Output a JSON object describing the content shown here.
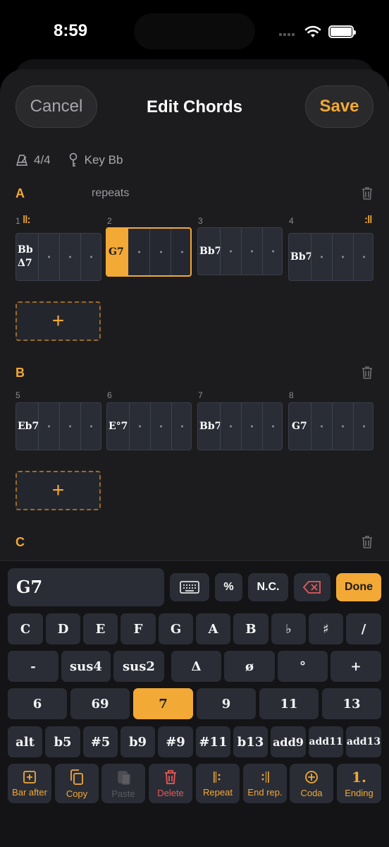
{
  "status_bar": {
    "time": "8:59"
  },
  "header": {
    "cancel_label": "Cancel",
    "title": "Edit Chords",
    "save_label": "Save"
  },
  "meta": {
    "time_signature": "4/4",
    "key": "Key Bb"
  },
  "sections": {
    "a": {
      "letter": "A",
      "note": "repeats",
      "bars": [
        {
          "num": "1",
          "chord_line1": "Bb",
          "chord_line2": "Δ7"
        },
        {
          "num": "2",
          "chord": "G7",
          "selected": true
        },
        {
          "num": "3",
          "chord": "Bb7"
        },
        {
          "num": "4",
          "chord": "Bb7"
        }
      ]
    },
    "b": {
      "letter": "B",
      "bars": [
        {
          "num": "5",
          "chord": "Eb7"
        },
        {
          "num": "6",
          "chord": "E°7"
        },
        {
          "num": "7",
          "chord": "Bb7"
        },
        {
          "num": "8",
          "chord": "G7"
        }
      ]
    },
    "c": {
      "letter": "C"
    }
  },
  "add_measure_label": "+",
  "keyboard": {
    "current_chord": "G7",
    "percent_label": "%",
    "nc_label": "N.C.",
    "done_label": "Done",
    "row_roots": [
      "C",
      "D",
      "E",
      "F",
      "G",
      "A",
      "B",
      "♭",
      "♯",
      "/"
    ],
    "row_quality": [
      "-",
      "sus4",
      "sus2",
      "Δ",
      "ø",
      "°",
      "+"
    ],
    "row_ext": [
      "6",
      "69",
      "7",
      "9",
      "11",
      "13"
    ],
    "active_ext": "7",
    "row_alt": [
      "alt",
      "b5",
      "#5",
      "b9",
      "#9",
      "#11",
      "b13",
      "add9",
      "add11",
      "add13"
    ],
    "actions": [
      {
        "label": "Bar after",
        "icon": "plus-square-icon"
      },
      {
        "label": "Copy",
        "icon": "copy-icon"
      },
      {
        "label": "Paste",
        "icon": "paste-icon",
        "disabled": true
      },
      {
        "label": "Delete",
        "icon": "trash-icon"
      },
      {
        "label": "Repeat",
        "icon": "repeat-start-icon"
      },
      {
        "label": "End rep.",
        "icon": "repeat-end-icon"
      },
      {
        "label": "Coda",
        "icon": "coda-icon"
      },
      {
        "label": "Ending",
        "icon": "ending-icon",
        "glyph": "1."
      }
    ]
  },
  "colors": {
    "accent": "#f2a935",
    "danger": "#e8595a",
    "background": "#1c1c1e",
    "cell": "#2a2d36"
  }
}
